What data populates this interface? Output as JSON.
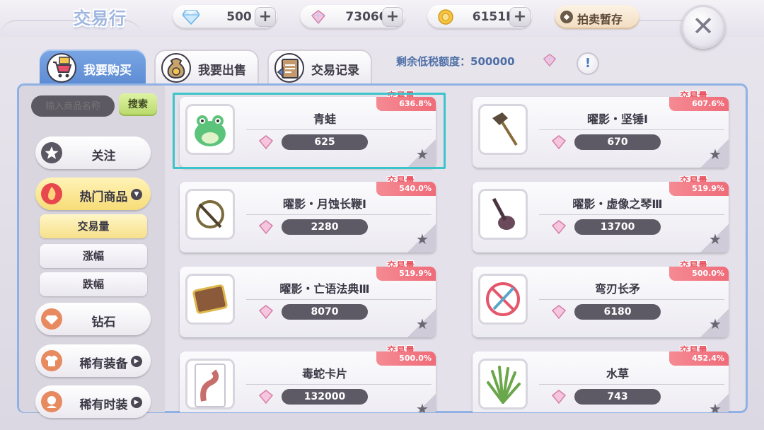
{
  "header": {
    "title": "交易行",
    "diamonds": "500",
    "crystals": "73060",
    "zeny": "6151K",
    "auction_label": "拍卖暂存",
    "plus": "+",
    "close": "✕"
  },
  "tabs": [
    {
      "label": "我要购买",
      "icon": "shopping-cart-icon"
    },
    {
      "label": "我要出售",
      "icon": "money-bag-icon"
    },
    {
      "label": "交易记录",
      "icon": "record-book-icon"
    }
  ],
  "tax": {
    "label": "剩余低税额度：500000",
    "info": "!"
  },
  "search": {
    "placeholder": "输入商品名称",
    "button": "搜索"
  },
  "sidebar": {
    "follow": "关注",
    "hot": "热门商品",
    "sub": [
      "交易量",
      "涨幅",
      "跌幅"
    ],
    "diamond": "钻石",
    "rare_equip": "稀有装备",
    "rare_fashion": "稀有时装"
  },
  "badge_tag": "交易量",
  "items": [
    {
      "name": "青蛙",
      "price": "625",
      "pct": "636.8%",
      "icon": "frog-icon"
    },
    {
      "name": "曜影・坚锤Ⅰ",
      "price": "670",
      "pct": "607.6%",
      "icon": "hammer-icon"
    },
    {
      "name": "曜影・月蚀长鞭Ⅰ",
      "price": "2280",
      "pct": "540.0%",
      "icon": "whip-icon"
    },
    {
      "name": "曜影・虚像之琴Ⅲ",
      "price": "13700",
      "pct": "519.9%",
      "icon": "lute-icon"
    },
    {
      "name": "曜影・亡语法典Ⅲ",
      "price": "8070",
      "pct": "519.9%",
      "icon": "tome-icon"
    },
    {
      "name": "弯刃长矛",
      "price": "6180",
      "pct": "500.0%",
      "icon": "spear-icon"
    },
    {
      "name": "毒蛇卡片",
      "price": "132000",
      "pct": "500.0%",
      "icon": "snake-card-icon"
    },
    {
      "name": "水草",
      "price": "743",
      "pct": "452.4%",
      "icon": "water-grass-icon"
    }
  ],
  "colors": {
    "accent": "#5d8bd3",
    "highlight": "#3bc4c9",
    "badge": "#ef6b78"
  }
}
